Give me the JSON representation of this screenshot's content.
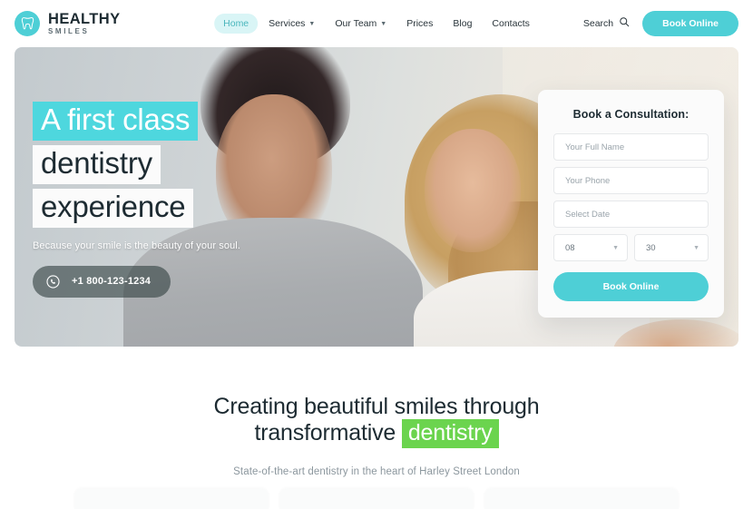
{
  "brand": {
    "name": "HEALTHY",
    "tagline": "SMILES",
    "logo_icon": "tooth-icon",
    "accent_color": "#4ecfd6"
  },
  "nav": {
    "items": [
      {
        "label": "Home",
        "active": true,
        "has_dropdown": false
      },
      {
        "label": "Services",
        "active": false,
        "has_dropdown": true
      },
      {
        "label": "Our Team",
        "active": false,
        "has_dropdown": true
      },
      {
        "label": "Prices",
        "active": false,
        "has_dropdown": false
      },
      {
        "label": "Blog",
        "active": false,
        "has_dropdown": false
      },
      {
        "label": "Contacts",
        "active": false,
        "has_dropdown": false
      }
    ]
  },
  "header": {
    "search_label": "Search",
    "search_icon": "search-icon",
    "book_button": "Book Online"
  },
  "hero": {
    "headline_lines": [
      "A first class",
      "dentistry",
      "experience"
    ],
    "subtitle": "Because your smile is the beauty of your soul.",
    "phone": "+1 800-123-1234",
    "phone_icon": "phone-icon",
    "highlight_teal": "#4ed7de",
    "highlight_white": "#fbfbfb"
  },
  "booking_form": {
    "title": "Book a Consultation:",
    "name_placeholder": "Your Full Name",
    "phone_placeholder": "Your Phone",
    "date_placeholder": "Select Date",
    "hour_value": "08",
    "minute_value": "30",
    "submit_label": "Book Online"
  },
  "section": {
    "heading_part1": "Creating beautiful smiles through",
    "heading_part2": "transformative",
    "heading_highlight": "dentistry",
    "highlight_color": "#6bd44e",
    "subtitle": "State-of-the-art dentistry in the heart of Harley Street London"
  }
}
